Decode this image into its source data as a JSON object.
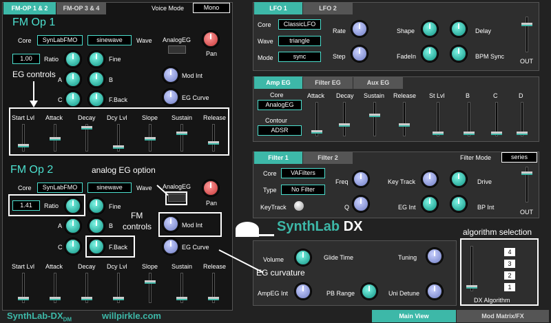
{
  "fm_tabs": [
    "FM-OP 1 & 2",
    "FM-OP 3 & 4"
  ],
  "voice_mode": {
    "label": "Voice Mode",
    "value": "Mono"
  },
  "op1": {
    "title": "FM Op 1",
    "core_label": "Core",
    "core": "SynLabFMO",
    "wave": "sinewave",
    "wave_label": "Wave",
    "analog_eg": "AnalogEG",
    "pan": "Pan",
    "ratio_val": "1.00",
    "ratio": "Ratio",
    "fine": "Fine",
    "a": "A",
    "b": "B",
    "c": "C",
    "fback": "F.Back",
    "mod_int": "Mod Int",
    "eg_curve": "EG Curve"
  },
  "op2": {
    "title": "FM Op 2",
    "core_label": "Core",
    "core": "SynLabFMO",
    "wave": "sinewave",
    "wave_label": "Wave",
    "analog_eg": "AnalogEG",
    "pan": "Pan",
    "ratio_val": "1.41",
    "ratio": "Ratio",
    "fine": "Fine",
    "a": "A",
    "b": "B",
    "c": "C",
    "fback": "F.Back",
    "mod_int": "Mod Int",
    "eg_curve": "EG Curve"
  },
  "eg_labels": [
    "Start Lvl",
    "Attack",
    "Decay",
    "Dcy Lvl",
    "Slope",
    "Sustain",
    "Release"
  ],
  "annotations": {
    "eg_controls": "EG controls",
    "analog_eg_option": "analog EG option",
    "fm_controls": "FM\ncontrols",
    "eg_curvature": "EG curvature",
    "algorithm_selection": "algorithm selection"
  },
  "lfo": {
    "tabs": [
      "LFO 1",
      "LFO 2"
    ],
    "core_label": "Core",
    "core": "ClassicLFO",
    "wave_label": "Wave",
    "wave": "triangle",
    "mode_label": "Mode",
    "mode": "sync",
    "rate": "Rate",
    "step": "Step",
    "shape": "Shape",
    "delay": "Delay",
    "fadein": "FadeIn",
    "bpm_sync": "BPM Sync",
    "out": "OUT"
  },
  "amp": {
    "tabs": [
      "Amp EG",
      "Filter EG",
      "Aux EG"
    ],
    "core_label": "Core",
    "core": "AnalogEG",
    "contour_label": "Contour",
    "contour": "ADSR",
    "sliders": [
      "Attack",
      "Decay",
      "Sustain",
      "Release",
      "St Lvl",
      "B",
      "C",
      "D"
    ]
  },
  "filter": {
    "tabs": [
      "Filter 1",
      "Filter 2"
    ],
    "mode_label": "Filter Mode",
    "mode": "series",
    "core_label": "Core",
    "core": "VAFilters",
    "type_label": "Type",
    "type": "No Filter",
    "keytrack": "KeyTrack",
    "freq": "Freq",
    "q": "Q",
    "key_track": "Key Track",
    "eg_int": "EG Int",
    "drive": "Drive",
    "bp_int": "BP Int",
    "out": "OUT"
  },
  "logo": {
    "synthlab": "SynthLab",
    "dx": "DX"
  },
  "global": {
    "volume": "Volume",
    "glide": "Glide Time",
    "tuning": "Tuning",
    "ampeg": "AmpEG Int",
    "pbrange": "PB Range",
    "unidetune": "Uni Detune"
  },
  "algo": {
    "label": "DX Algorithm",
    "ops": [
      "4",
      "3",
      "2",
      "1"
    ]
  },
  "footer": {
    "brand": "SynthLab-DX",
    "dm": "DM",
    "site": "willpirkle.com",
    "main_view": "Main View",
    "mod_matrix": "Mod Matrix/FX"
  }
}
